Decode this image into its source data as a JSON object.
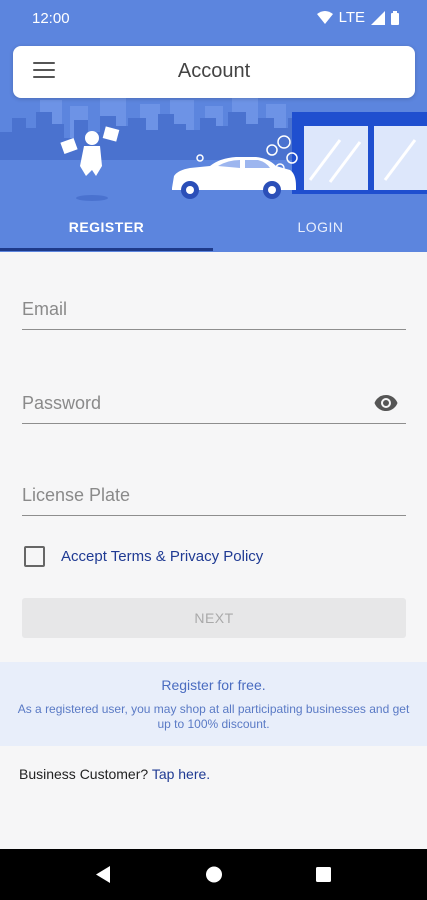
{
  "status_bar": {
    "time": "12:00",
    "network": "LTE"
  },
  "app_bar": {
    "title": "Account",
    "menu_icon": "hamburger-menu-icon"
  },
  "tabs": [
    {
      "label": "REGISTER",
      "active": true
    },
    {
      "label": "LOGIN",
      "active": false
    }
  ],
  "form": {
    "email": {
      "placeholder": "Email",
      "value": ""
    },
    "password": {
      "placeholder": "Password",
      "value": "",
      "toggle_icon": "eye-icon"
    },
    "license_plate": {
      "placeholder": "License Plate",
      "value": ""
    },
    "terms": {
      "label": "Accept Terms & Privacy Policy",
      "checked": false
    },
    "next_label": "NEXT"
  },
  "info": {
    "headline": "Register for free.",
    "description": "As a registered user, you may shop at all participating businesses and get up to 100% discount."
  },
  "business": {
    "prompt": "Business Customer?",
    "link": "Tap here."
  },
  "colors": {
    "primary": "#5c85de",
    "indicator": "#1e3a8a",
    "link": "#1f3a93",
    "info_bg": "#e8eefa"
  }
}
